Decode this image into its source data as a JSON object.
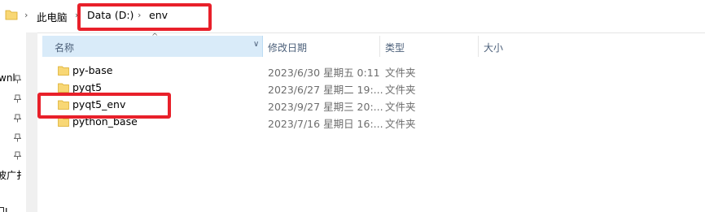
{
  "breadcrumb": {
    "root": "此电脑",
    "drive": "Data (D:)",
    "folder": "env"
  },
  "nav_pane": {
    "items": [
      "wnl",
      "波广扌",
      "门J"
    ]
  },
  "columns": {
    "name": "名称",
    "date": "修改日期",
    "type": "类型",
    "size": "大小"
  },
  "files": [
    {
      "name": "py-base",
      "date": "2023/6/30 星期五 0:11",
      "type": "文件夹",
      "size": ""
    },
    {
      "name": "pyqt5",
      "date": "2023/6/27 星期二 19:...",
      "type": "文件夹",
      "size": ""
    },
    {
      "name": "pyqt5_env",
      "date": "2023/9/27 星期三 20:...",
      "type": "文件夹",
      "size": ""
    },
    {
      "name": "python_base",
      "date": "2023/7/16 星期日 16:...",
      "type": "文件夹",
      "size": ""
    }
  ],
  "colors": {
    "highlight": "#e8202a",
    "folder": "#f8d775",
    "header_selected": "#d9ebf9"
  }
}
